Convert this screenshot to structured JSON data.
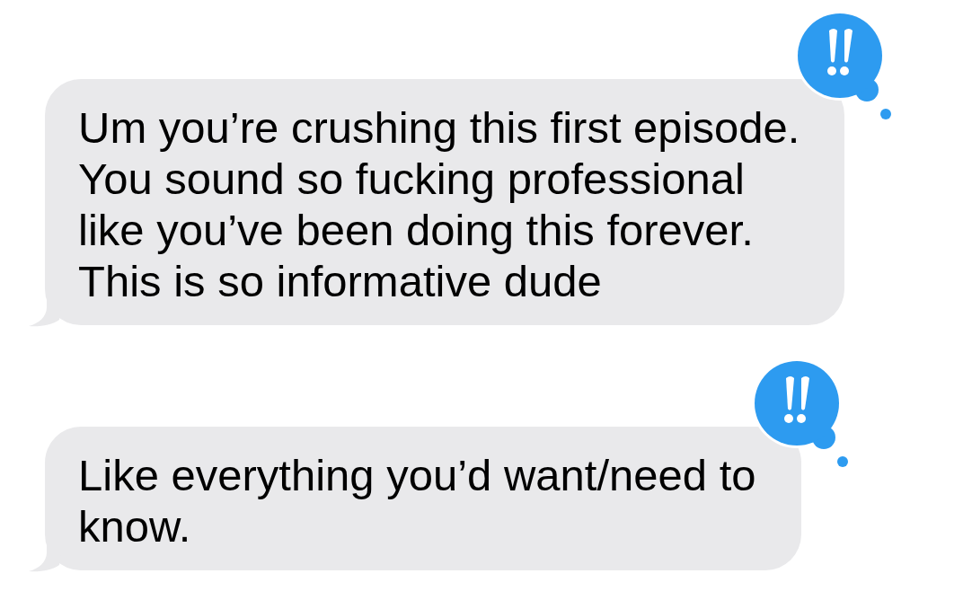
{
  "messages": [
    {
      "text": "Um you’re crushing this first episode.\nYou sound so fucking professional\nlike you’ve been doing this forever.\nThis is so informative dude",
      "emphasized": true
    },
    {
      "text": "Like everything you’d want/need to\nknow.",
      "emphasized": true
    }
  ]
}
